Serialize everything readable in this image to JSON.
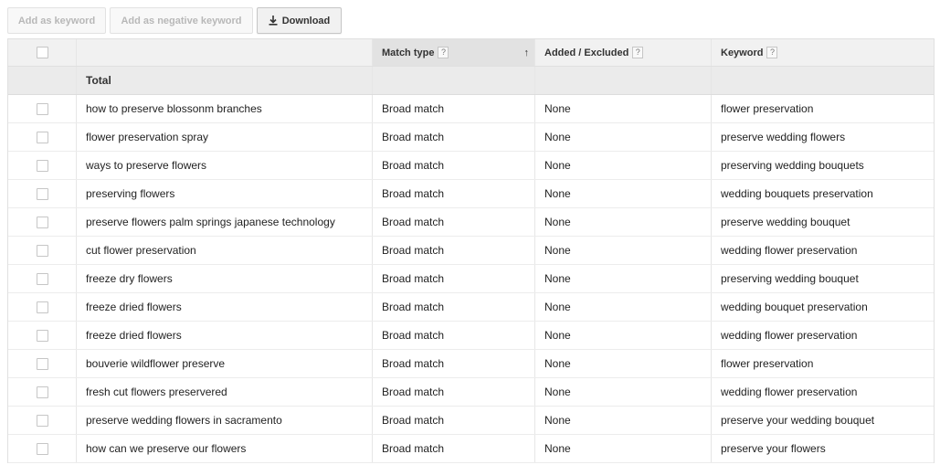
{
  "toolbar": {
    "add_keyword": "Add as keyword",
    "add_negative": "Add as negative keyword",
    "download": "Download"
  },
  "table": {
    "headers": {
      "match_type": "Match type",
      "added_excluded": "Added / Excluded",
      "keyword": "Keyword",
      "help": "?",
      "sort_indicator": "↑"
    },
    "total_label": "Total",
    "rows": [
      {
        "term": "how to preserve blossonm branches",
        "match": "Broad match",
        "added": "None",
        "keyword": "flower preservation"
      },
      {
        "term": "flower preservation spray",
        "match": "Broad match",
        "added": "None",
        "keyword": "preserve wedding flowers"
      },
      {
        "term": "ways to preserve flowers",
        "match": "Broad match",
        "added": "None",
        "keyword": "preserving wedding bouquets"
      },
      {
        "term": "preserving flowers",
        "match": "Broad match",
        "added": "None",
        "keyword": "wedding bouquets preservation"
      },
      {
        "term": "preserve flowers palm springs japanese technology",
        "match": "Broad match",
        "added": "None",
        "keyword": "preserve wedding bouquet"
      },
      {
        "term": "cut flower preservation",
        "match": "Broad match",
        "added": "None",
        "keyword": "wedding flower preservation"
      },
      {
        "term": "freeze dry flowers",
        "match": "Broad match",
        "added": "None",
        "keyword": "preserving wedding bouquet"
      },
      {
        "term": "freeze dried flowers",
        "match": "Broad match",
        "added": "None",
        "keyword": "wedding bouquet preservation"
      },
      {
        "term": "freeze dried flowers",
        "match": "Broad match",
        "added": "None",
        "keyword": "wedding flower preservation"
      },
      {
        "term": "bouverie wildflower preserve",
        "match": "Broad match",
        "added": "None",
        "keyword": "flower preservation"
      },
      {
        "term": "fresh cut flowers preservered",
        "match": "Broad match",
        "added": "None",
        "keyword": "wedding flower preservation"
      },
      {
        "term": "preserve wedding flowers in sacramento",
        "match": "Broad match",
        "added": "None",
        "keyword": "preserve your wedding bouquet"
      },
      {
        "term": "how can we preserve our flowers",
        "match": "Broad match",
        "added": "None",
        "keyword": "preserve your flowers"
      }
    ]
  }
}
